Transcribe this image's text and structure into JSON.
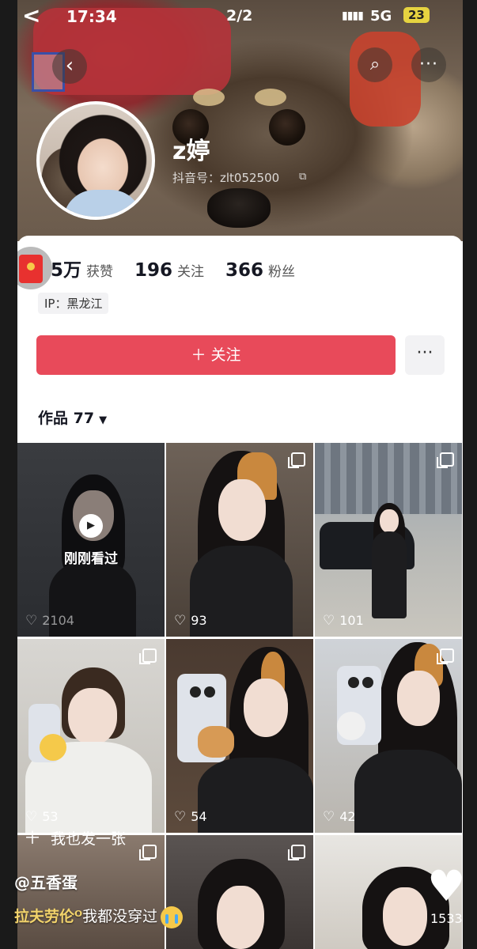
{
  "status_bar": {
    "back_glyph": "<",
    "time": "17:34",
    "page_indicator": "2/2",
    "signal": "▮▮▮▮",
    "network": "5G",
    "battery": "23"
  },
  "profile": {
    "name": "z婷",
    "douyin_id": "抖音号：zlt052500",
    "stats": [
      {
        "value": "5万",
        "label": "获赞"
      },
      {
        "value": "196",
        "label": "关注"
      },
      {
        "value": "366",
        "label": "粉丝"
      }
    ],
    "ip": "IP：黑龙江",
    "follow_label": "＋ 关注",
    "more_label": "···"
  },
  "works_tab": {
    "label": "作品 77",
    "caret": "▼"
  },
  "grid": {
    "recent_label": "刚刚看过",
    "items": [
      {
        "likes": "2104"
      },
      {
        "likes": "93"
      },
      {
        "likes": "101"
      },
      {
        "likes": "53"
      },
      {
        "likes": "54"
      },
      {
        "likes": "42"
      }
    ]
  },
  "overlay": {
    "post_label": "我也发一张",
    "username": "@五香蛋",
    "comment_user": "拉夫劳伦ᴼ",
    "comment_text": "我都没穿过",
    "like_count": "1533"
  },
  "icons": {
    "back": "back-icon",
    "search": "search-icon",
    "more": "more-icon",
    "heart": "heart-icon"
  },
  "colors": {
    "follow_button": "#e84a5a",
    "comment_user": "#f2d36b",
    "battery_badge": "#e6d340"
  }
}
